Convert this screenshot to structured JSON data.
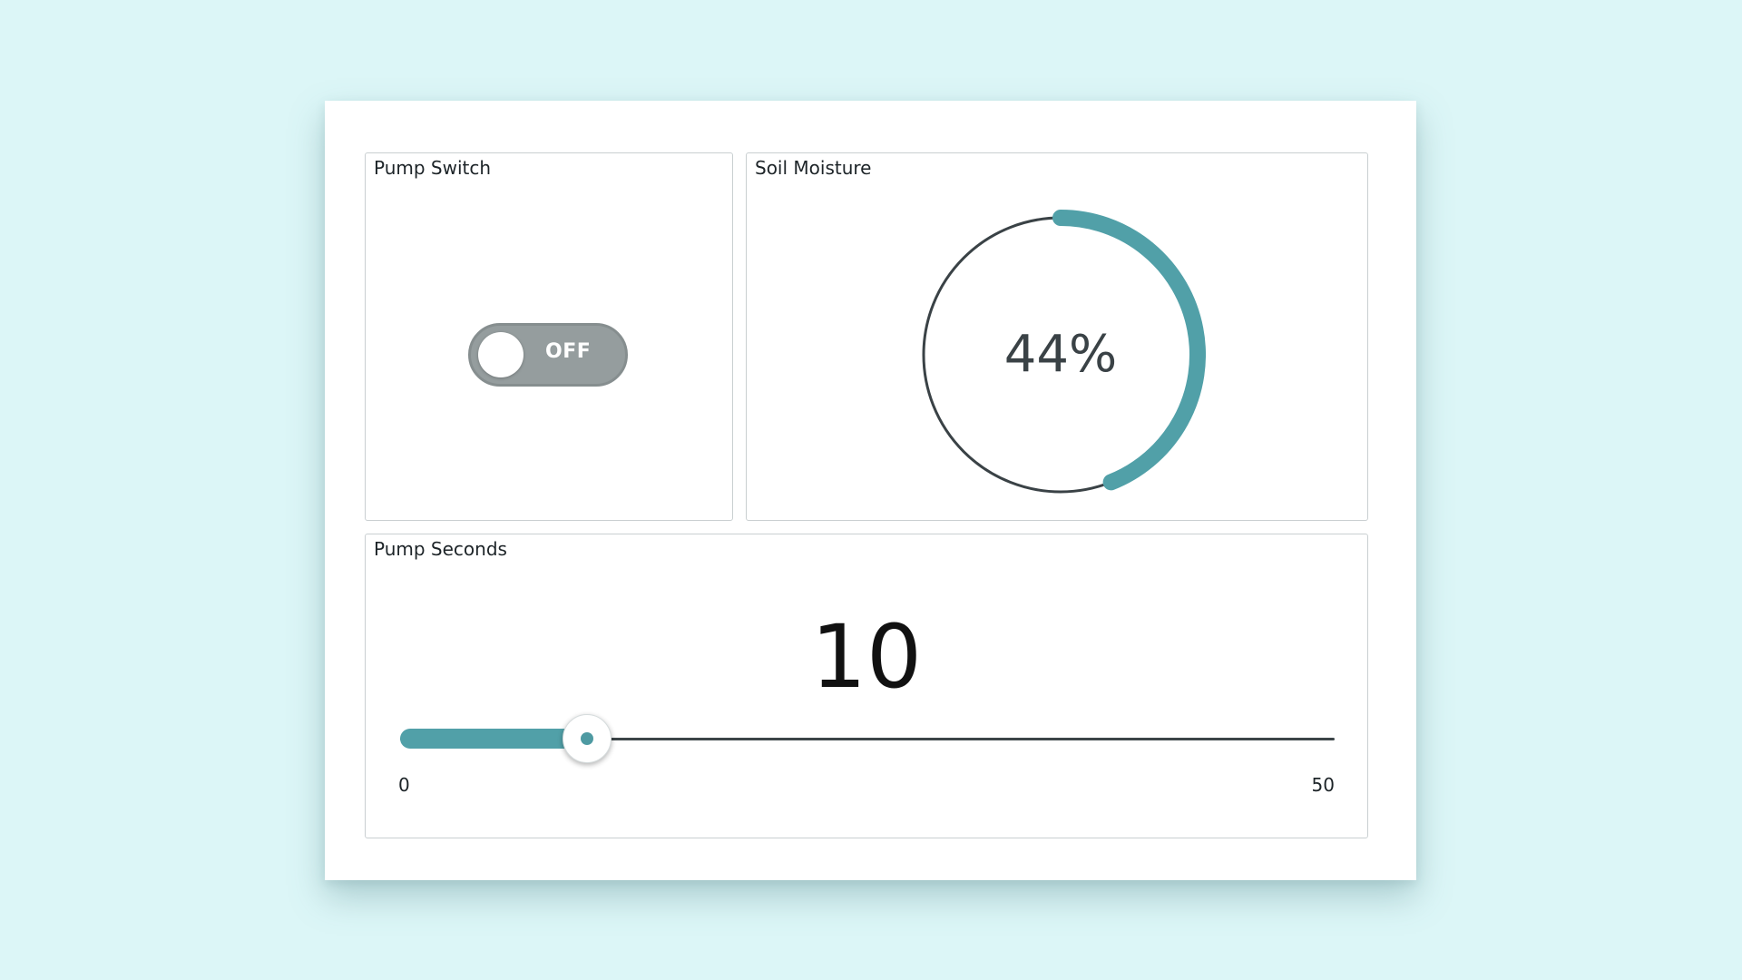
{
  "pump_switch": {
    "title": "Pump Switch",
    "state_label": "OFF",
    "is_on": false
  },
  "soil_moisture": {
    "title": "Soil Moisture",
    "value_text": "44%",
    "value_percent": 44
  },
  "pump_seconds": {
    "title": "Pump Seconds",
    "value": "10",
    "min": "0",
    "max": "50"
  },
  "colors": {
    "page_background": "#dcf6f7",
    "accent": "#51a0a8",
    "toggle_off": "#959d9e",
    "gauge_track": "#3a4246"
  }
}
